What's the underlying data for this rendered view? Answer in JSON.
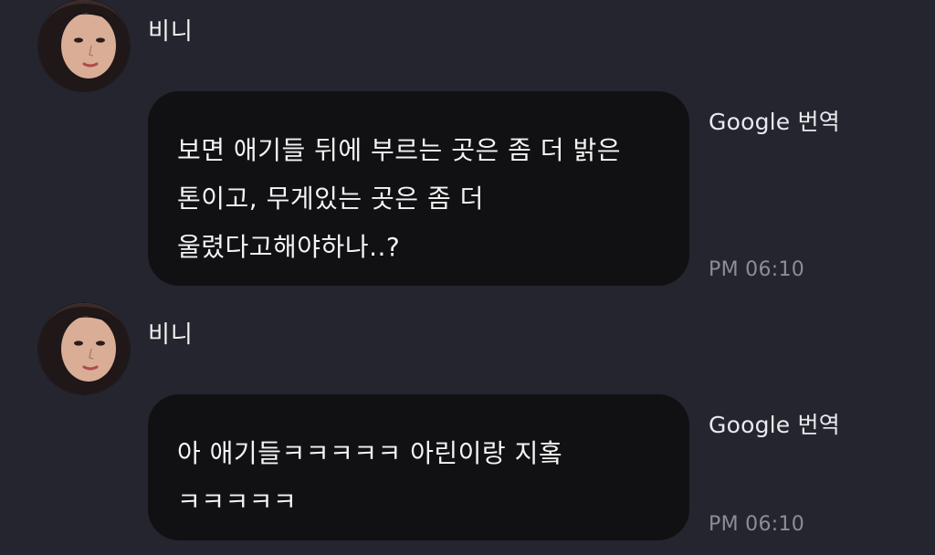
{
  "messages": [
    {
      "sender": "비니",
      "text": "보면 애기들 뒤에 부르는 곳은 좀 더 밝은 톤이고, 무게있는 곳은 좀 더 울렸다고해야하나..?",
      "translate_label": "Google 번역",
      "time": "PM 06:10",
      "avatar_icon": "profile-photo"
    },
    {
      "sender": "비니",
      "text": "아 애기들ㅋㅋㅋㅋㅋ 아린이랑 지홐 ㅋㅋㅋㅋㅋ",
      "translate_label": "Google 번역",
      "time": "PM 06:10",
      "avatar_icon": "profile-photo"
    }
  ],
  "colors": {
    "background": "#25252f",
    "bubble": "#111114",
    "text": "#f4f4f4",
    "timestamp": "#8d8d96"
  }
}
